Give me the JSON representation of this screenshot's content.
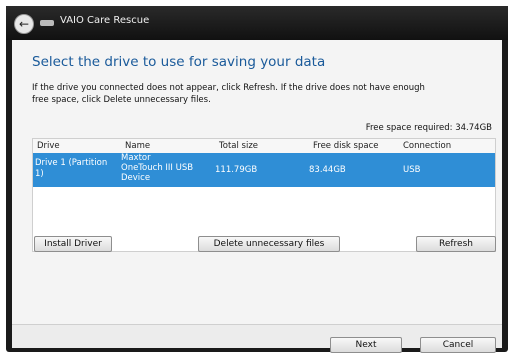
{
  "window": {
    "title": "VAIO Care Rescue"
  },
  "main": {
    "heading": "Select the drive to use for saving your data",
    "info_line1": "If the drive you connected does not appear, click Refresh. If the drive does not have enough",
    "info_line2": "free space, click Delete unnecessary files.",
    "free_space_required": "Free space required: 34.74GB"
  },
  "table": {
    "columns": [
      "Drive",
      "Name",
      "Total size",
      "Free disk space",
      "Connection"
    ],
    "rows": [
      {
        "drive_line1": "Drive 1 (Partition",
        "drive_line2": "1)",
        "name_line1": "Maxtor",
        "name_line2": "OneTouch III USB",
        "name_line3": "Device",
        "total": "111.79GB",
        "free": "83.44GB",
        "connection": "USB"
      }
    ]
  },
  "buttons": {
    "install_driver": "Install Driver",
    "delete_files": "Delete unnecessary files",
    "refresh": "Refresh",
    "next": "Next",
    "cancel": "Cancel"
  },
  "icons": {
    "back": "back-arrow-icon",
    "app": "app-icon"
  }
}
